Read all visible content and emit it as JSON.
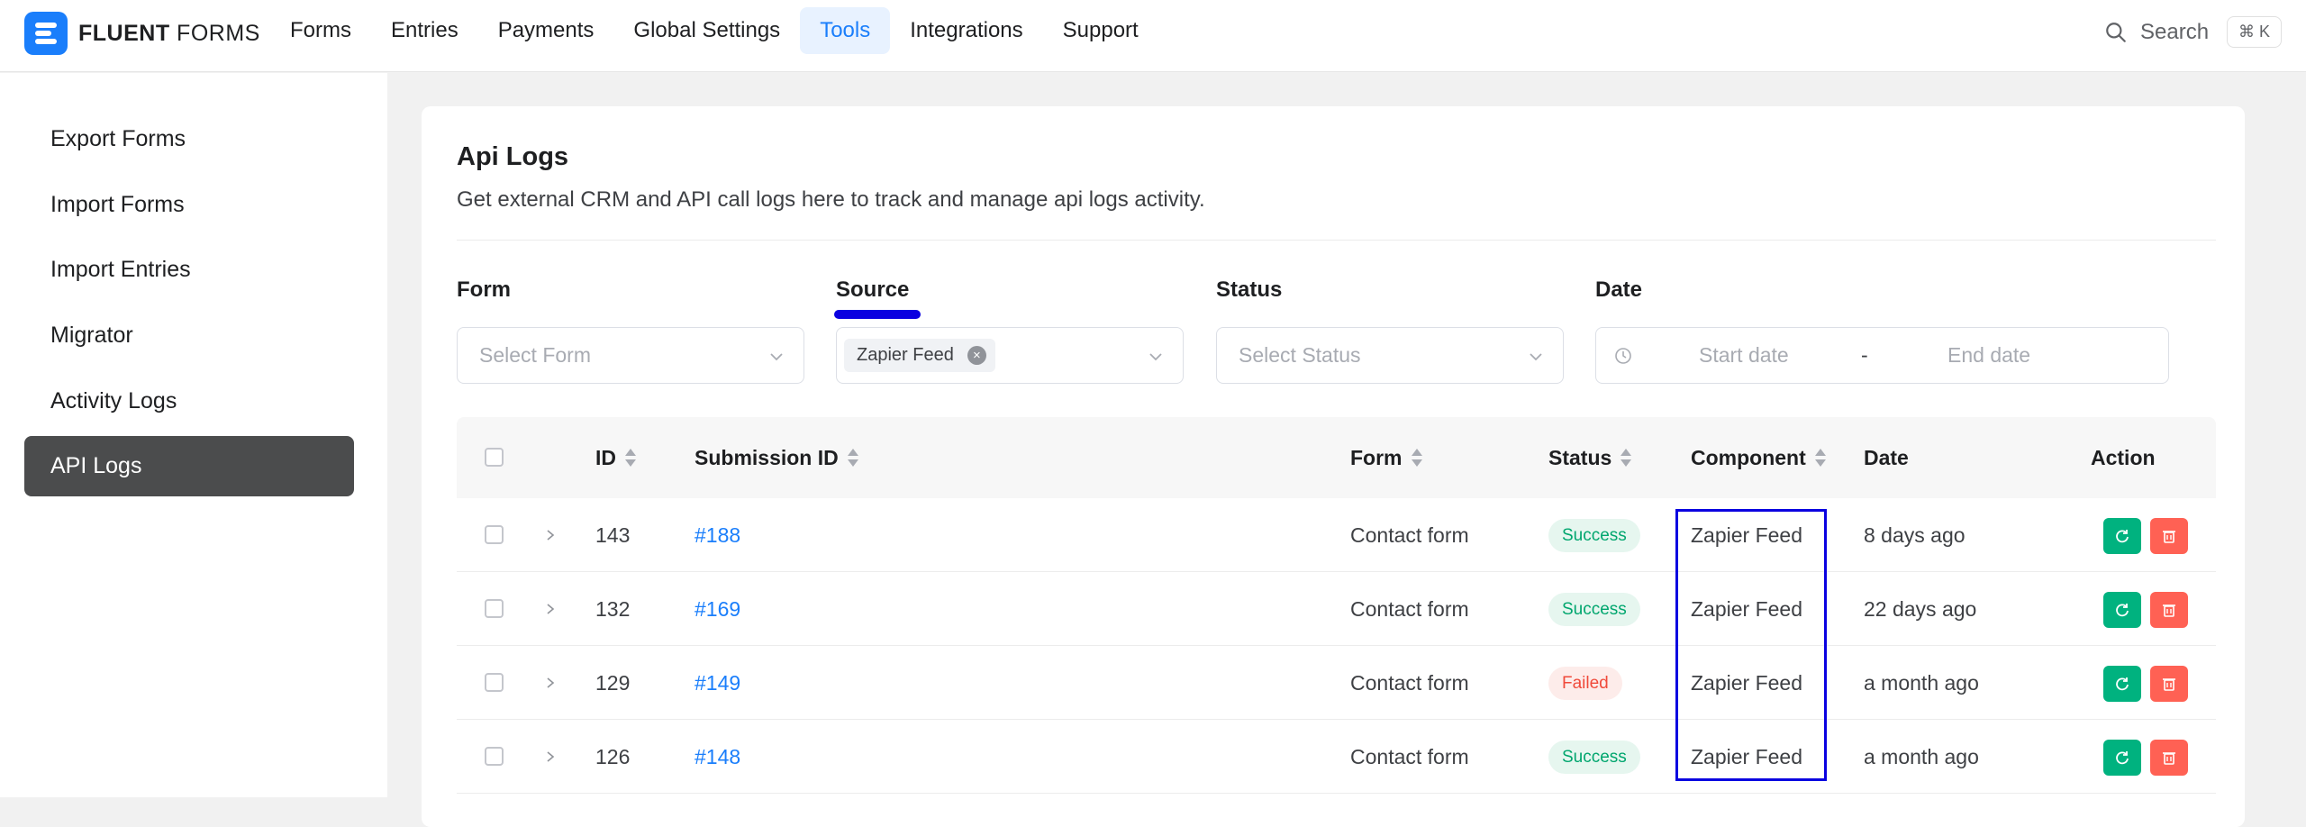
{
  "brand": {
    "name_bold": "FLUENT",
    "name_rest": " FORMS"
  },
  "nav": [
    {
      "label": "Forms",
      "active": false
    },
    {
      "label": "Entries",
      "active": false
    },
    {
      "label": "Payments",
      "active": false
    },
    {
      "label": "Global Settings",
      "active": false
    },
    {
      "label": "Tools",
      "active": true
    },
    {
      "label": "Integrations",
      "active": false
    },
    {
      "label": "Support",
      "active": false
    }
  ],
  "search": {
    "label": "Search",
    "shortcut": "⌘ K"
  },
  "sidebar": [
    {
      "label": "Export Forms"
    },
    {
      "label": "Import Forms"
    },
    {
      "label": "Import Entries"
    },
    {
      "label": "Migrator"
    },
    {
      "label": "Activity Logs"
    },
    {
      "label": "API Logs",
      "active": true
    }
  ],
  "page": {
    "title": "Api Logs",
    "description": "Get external CRM and API call logs here to track and manage api logs activity."
  },
  "filters": {
    "form": {
      "label": "Form",
      "placeholder": "Select Form"
    },
    "source": {
      "label": "Source",
      "tag": "Zapier Feed"
    },
    "status": {
      "label": "Status",
      "placeholder": "Select Status"
    },
    "date": {
      "label": "Date",
      "start_placeholder": "Start date",
      "separator": "-",
      "end_placeholder": "End date"
    }
  },
  "table": {
    "headers": {
      "id": "ID",
      "submission_id": "Submission ID",
      "form": "Form",
      "status": "Status",
      "component": "Component",
      "date": "Date",
      "action": "Action"
    },
    "rows": [
      {
        "id": "143",
        "submission_id": "#188",
        "form": "Contact form",
        "status": "Success",
        "component": "Zapier Feed",
        "date": "8 days ago"
      },
      {
        "id": "132",
        "submission_id": "#169",
        "form": "Contact form",
        "status": "Success",
        "component": "Zapier Feed",
        "date": "22 days ago"
      },
      {
        "id": "129",
        "submission_id": "#149",
        "form": "Contact form",
        "status": "Failed",
        "component": "Zapier Feed",
        "date": "a month ago"
      },
      {
        "id": "126",
        "submission_id": "#148",
        "form": "Contact form",
        "status": "Success",
        "component": "Zapier Feed",
        "date": "a month ago"
      }
    ]
  },
  "colors": {
    "accent": "#1a7efb",
    "annotation": "#0a00e0",
    "success": "#00b27f",
    "danger": "#ff6154",
    "sidebar_active": "#4b4c4d"
  }
}
